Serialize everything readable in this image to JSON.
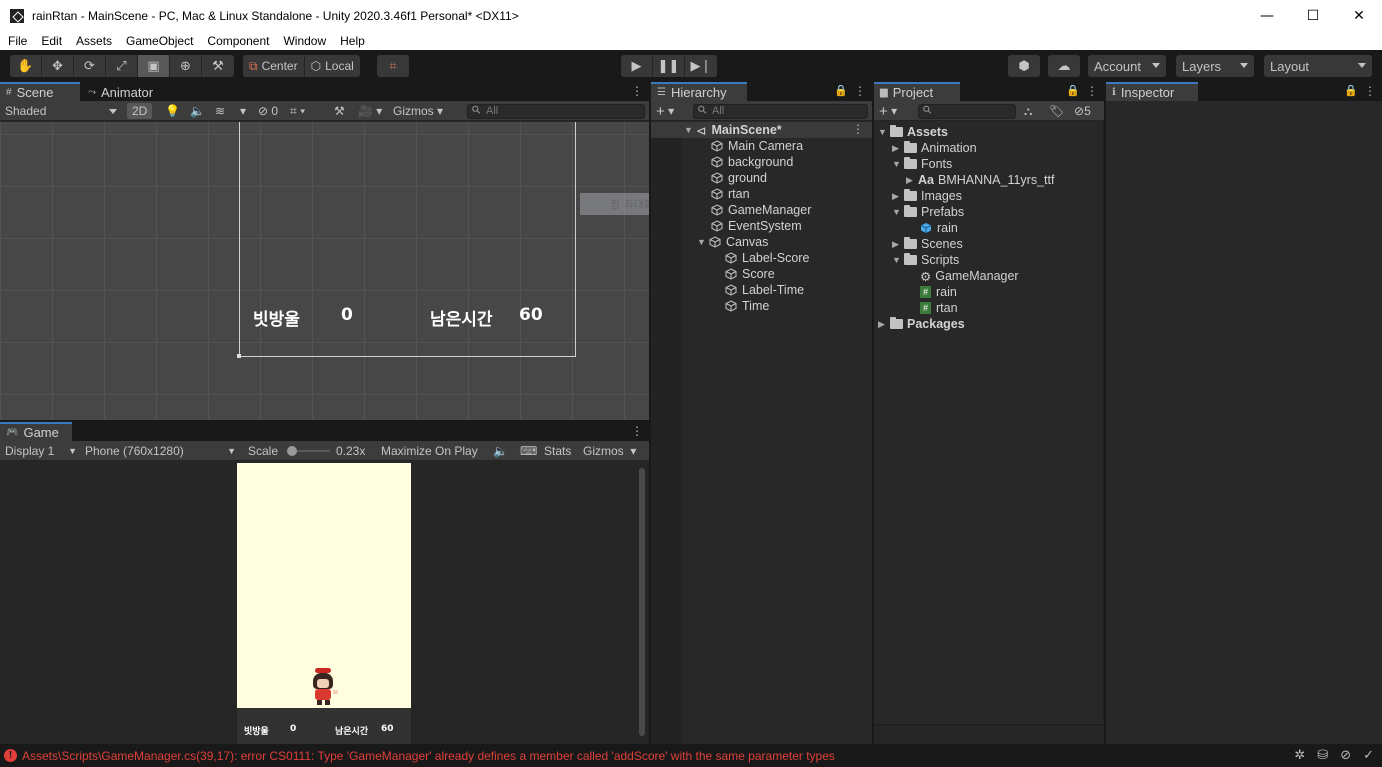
{
  "window": {
    "title": "rainRtan - MainScene - PC, Mac & Linux Standalone - Unity 2020.3.46f1 Personal* <DX11>",
    "minimize": "—",
    "maximize": "☐",
    "close": "✕"
  },
  "menu": [
    "File",
    "Edit",
    "Assets",
    "GameObject",
    "Component",
    "Window",
    "Help"
  ],
  "toolbar": {
    "pivot_label": "Center",
    "space_label": "Local",
    "account_label": "Account",
    "layers_label": "Layers",
    "layout_label": "Layout"
  },
  "scene": {
    "tab_scene": "Scene",
    "tab_animator": "Animator",
    "shading": "Shaded",
    "mode_2d": "2D",
    "hidden_count": "0",
    "gizmos": "Gizmos",
    "search_placeholder": "All",
    "label_score": "빗방울",
    "score_value": "0",
    "label_time": "남은시간",
    "time_value": "60",
    "tooltip": "창 최대화(W)"
  },
  "game": {
    "tab": "Game",
    "display": "Display 1",
    "resolution": "Phone (760x1280)",
    "scale_label": "Scale",
    "scale_value": "0.23x",
    "maximize": "Maximize On Play",
    "stats": "Stats",
    "gizmos": "Gizmos",
    "label_score": "빗방울",
    "score_value": "0",
    "label_time": "남은시간",
    "time_value": "60"
  },
  "hierarchy": {
    "tab": "Hierarchy",
    "search_placeholder": "All",
    "scene_name": "MainScene*",
    "items": [
      {
        "label": "Main Camera"
      },
      {
        "label": "background"
      },
      {
        "label": "ground"
      },
      {
        "label": "rtan"
      },
      {
        "label": "GameManager"
      },
      {
        "label": "EventSystem"
      },
      {
        "label": "Canvas"
      },
      {
        "label": "Label-Score"
      },
      {
        "label": "Score"
      },
      {
        "label": "Label-Time"
      },
      {
        "label": "Time"
      }
    ]
  },
  "project": {
    "tab": "Project",
    "hidden_count": "5",
    "items": [
      {
        "label": "Assets"
      },
      {
        "label": "Animation"
      },
      {
        "label": "Fonts"
      },
      {
        "label": "BMHANNA_11yrs_ttf"
      },
      {
        "label": "Images"
      },
      {
        "label": "Prefabs"
      },
      {
        "label": "rain"
      },
      {
        "label": "Scenes"
      },
      {
        "label": "Scripts"
      },
      {
        "label": "GameManager"
      },
      {
        "label": "rain"
      },
      {
        "label": "rtan"
      },
      {
        "label": "Packages"
      }
    ],
    "font_prefix": "Aa"
  },
  "inspector": {
    "tab": "Inspector"
  },
  "status": {
    "error": "Assets\\Scripts\\GameManager.cs(39,17): error CS0111: Type 'GameManager' already defines a member called 'addScore' with the same parameter types"
  },
  "colors": {
    "accent": "#3a79bb",
    "error": "#e0403a",
    "game_background": "#ffffe0"
  }
}
